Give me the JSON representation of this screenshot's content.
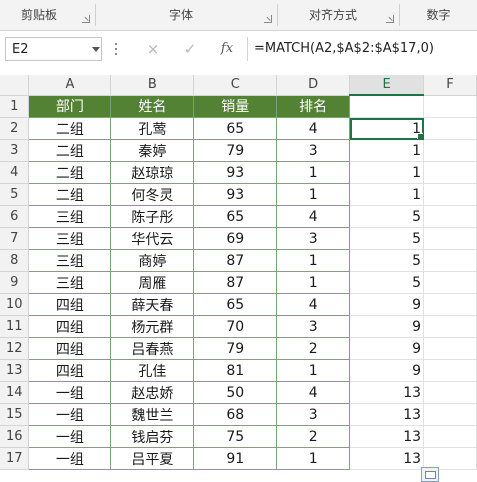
{
  "ribbon": {
    "groups": [
      "剪贴板",
      "字体",
      "对齐方式",
      "数字"
    ]
  },
  "formula_bar": {
    "name_box": "E2",
    "cancel_icon": "×",
    "enter_icon": "✓",
    "fx_label": "fx",
    "formula": "=MATCH(A2,$A$2:$A$17,0)"
  },
  "columns": [
    "A",
    "B",
    "C",
    "D",
    "E",
    "F"
  ],
  "header_row": {
    "row_num": "1",
    "dept": "部门",
    "name": "姓名",
    "sales": "销量",
    "rank": "排名",
    "e": ""
  },
  "rows": [
    {
      "n": "2",
      "dept": "二组",
      "name": "孔莺",
      "sales": "65",
      "rank": "4",
      "e": "1"
    },
    {
      "n": "3",
      "dept": "二组",
      "name": "秦婷",
      "sales": "79",
      "rank": "3",
      "e": "1"
    },
    {
      "n": "4",
      "dept": "二组",
      "name": "赵琼琼",
      "sales": "93",
      "rank": "1",
      "e": "1"
    },
    {
      "n": "5",
      "dept": "二组",
      "name": "何冬灵",
      "sales": "93",
      "rank": "1",
      "e": "1"
    },
    {
      "n": "6",
      "dept": "三组",
      "name": "陈子彤",
      "sales": "65",
      "rank": "4",
      "e": "5"
    },
    {
      "n": "7",
      "dept": "三组",
      "name": "华代云",
      "sales": "69",
      "rank": "3",
      "e": "5"
    },
    {
      "n": "8",
      "dept": "三组",
      "name": "商婷",
      "sales": "87",
      "rank": "1",
      "e": "5"
    },
    {
      "n": "9",
      "dept": "三组",
      "name": "周雁",
      "sales": "87",
      "rank": "1",
      "e": "5"
    },
    {
      "n": "10",
      "dept": "四组",
      "name": "薛天春",
      "sales": "65",
      "rank": "4",
      "e": "9"
    },
    {
      "n": "11",
      "dept": "四组",
      "name": "杨元群",
      "sales": "70",
      "rank": "3",
      "e": "9"
    },
    {
      "n": "12",
      "dept": "四组",
      "name": "吕春燕",
      "sales": "79",
      "rank": "2",
      "e": "9"
    },
    {
      "n": "13",
      "dept": "四组",
      "name": "孔佳",
      "sales": "81",
      "rank": "1",
      "e": "9"
    },
    {
      "n": "14",
      "dept": "一组",
      "name": "赵忠娇",
      "sales": "50",
      "rank": "4",
      "e": "13"
    },
    {
      "n": "15",
      "dept": "一组",
      "name": "魏世兰",
      "sales": "68",
      "rank": "3",
      "e": "13"
    },
    {
      "n": "16",
      "dept": "一组",
      "name": "钱启芬",
      "sales": "75",
      "rank": "2",
      "e": "13"
    },
    {
      "n": "17",
      "dept": "一组",
      "name": "吕平夏",
      "sales": "91",
      "rank": "1",
      "e": "13"
    }
  ],
  "colors": {
    "header_fill": "#548235",
    "accent": "#217346"
  }
}
